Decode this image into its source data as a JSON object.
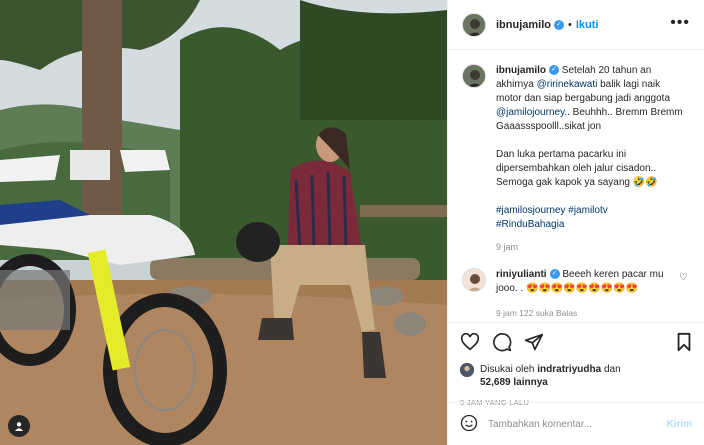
{
  "post": {
    "username": "ibnujamilo",
    "follow_label": "Ikuti",
    "separator": "•",
    "more_icon": "more-options-icon"
  },
  "caption": {
    "username": "ibnujamilo",
    "text_1": "Setelah 20 tahun an akhirnya",
    "mention_1": "@ririnekawati",
    "text_2": "balik lagi naik motor dan siap bergabung jadi anggota",
    "mention_2": "@jamilojourney",
    "text_3": ".. Beuhhh.. Bremm Bremm Gaaassspoolll..sikat jon",
    "paragraph_2": "Dan luka pertama pacarku ini dipersembahkan oleh jalur cisadon.. Semoga gak kapok ya sayang 🤣🤣",
    "hashtag_1": "#jamilosjourney",
    "hashtag_2": "#jamilotv",
    "hashtag_3": "#RinduBahagia",
    "age": "9 jam"
  },
  "comment": {
    "username": "riniyulianti",
    "text": "Beeeh keren pacar mu jooo. . 😍😍😍😍😍😍😍😍😍",
    "meta": "9 jam   122 suka   Balas"
  },
  "likes": {
    "prefix": "Disukai oleh",
    "user": "indratriyudha",
    "joiner": "dan",
    "count": "52,689 lainnya"
  },
  "timestamp": "9 JAM YANG LALU",
  "add_comment": {
    "placeholder": "Tambahkan komentar...",
    "post_label": "Kirim"
  },
  "colors": {
    "link": "#00376b",
    "accent": "#0095f6",
    "muted": "#8e8e8e"
  }
}
